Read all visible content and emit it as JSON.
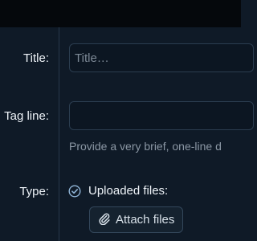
{
  "form": {
    "title_label": "Title:",
    "title_placeholder": "Title…",
    "tagline_label": "Tag line:",
    "tagline_help": "Provide a very brief, one-line d",
    "type_label": "Type:",
    "type_option": "Uploaded files:",
    "attach_label": "Attach files"
  },
  "icons": {
    "check": "check-circle-icon",
    "paperclip": "paperclip-icon"
  },
  "colors": {
    "background": "#0f1a27",
    "accent": "#8fb4d6"
  }
}
